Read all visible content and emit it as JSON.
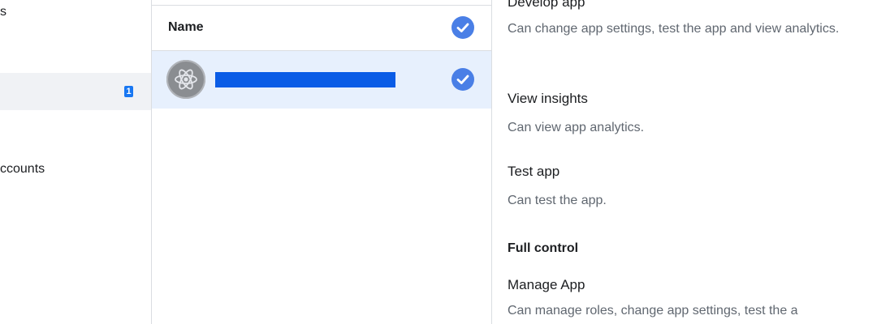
{
  "sidebar": {
    "top_fragment": "s",
    "active_item_badge": "1",
    "accounts_fragment": "ccounts"
  },
  "assets": {
    "header_label": "Name",
    "rows": [
      {
        "name_redacted": true,
        "selected": true
      }
    ]
  },
  "permissions": {
    "develop_app": {
      "title": "Develop app",
      "description": "Can change app settings, test the app and view analytics."
    },
    "view_insights": {
      "title": "View insights",
      "description": "Can view app analytics."
    },
    "test_app": {
      "title": "Test app",
      "description": "Can test the app."
    },
    "full_control_section": "Full control",
    "manage_app": {
      "title": "Manage App",
      "description": "Can manage roles, change app settings, test the a"
    }
  },
  "icons": {
    "check": "check-circle-icon",
    "avatar": "atom-app-icon"
  },
  "colors": {
    "accent": "#1877f2",
    "check_blue": "#4a7fe6",
    "selected_row": "#e7f0fd",
    "redaction": "#0a5ce6"
  }
}
